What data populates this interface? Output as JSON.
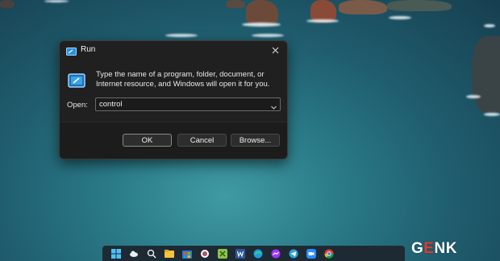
{
  "run_dialog": {
    "title": "Run",
    "description": "Type the name of a program, folder, document, or Internet resource, and Windows will open it for you.",
    "open_label": "Open:",
    "open_value": "control",
    "ok_label": "OK",
    "cancel_label": "Cancel",
    "browse_label": "Browse..."
  },
  "taskbar": {
    "icons": [
      "windows-start-icon",
      "weather-icon",
      "search-icon",
      "file-explorer-icon",
      "store-icon",
      "photos-icon",
      "greenshot-icon",
      "word-icon",
      "edge-icon",
      "messenger-icon",
      "telegram-icon",
      "zoom-icon",
      "chrome-icon"
    ]
  },
  "watermark": {
    "prefix": "G",
    "accent": "E",
    "suffix": "NK"
  },
  "colors": {
    "dialog_bg": "#202020",
    "sea": "#2a7a88",
    "accent": "#e23b2e"
  }
}
